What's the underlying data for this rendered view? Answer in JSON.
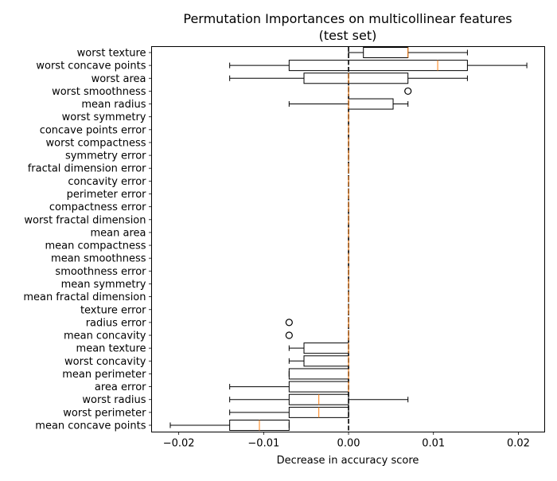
{
  "chart_data": {
    "type": "boxplot",
    "orientation": "horizontal",
    "title": "Permutation Importances on multicollinear features\n(test set)",
    "title_lines": [
      "Permutation Importances on multicollinear features",
      "(test set)"
    ],
    "xlabel": "Decrease in accuracy score",
    "ylabel": "",
    "xlim": [
      -0.0232,
      0.0231
    ],
    "xticks": [
      -0.02,
      -0.01,
      0.0,
      0.01,
      0.02
    ],
    "xtick_labels": [
      "−0.02",
      "−0.01",
      "0.00",
      "0.01",
      "0.02"
    ],
    "reference_line": {
      "x": 0,
      "style": "dashed",
      "color": "#000000"
    },
    "median_color": "#ff7f0e",
    "grid": false,
    "categories": [
      "worst texture",
      "worst concave points",
      "worst area",
      "worst smoothness",
      "mean radius",
      "worst symmetry",
      "concave points error",
      "worst compactness",
      "symmetry error",
      "fractal dimension error",
      "concavity error",
      "perimeter error",
      "compactness error",
      "worst fractal dimension",
      "mean area",
      "mean compactness",
      "mean smoothness",
      "smoothness error",
      "mean symmetry",
      "mean fractal dimension",
      "texture error",
      "radius error",
      "mean concavity",
      "mean texture",
      "worst concavity",
      "mean perimeter",
      "area error",
      "worst radius",
      "worst perimeter",
      "mean concave points"
    ],
    "boxes": [
      {
        "whisker_low": 0,
        "q1": 0.00175,
        "median": 0.007,
        "q3": 0.007,
        "whisker_high": 0.014,
        "outliers": []
      },
      {
        "whisker_low": -0.014,
        "q1": -0.007,
        "median": 0.0105,
        "q3": 0.014,
        "whisker_high": 0.021,
        "outliers": []
      },
      {
        "whisker_low": -0.014,
        "q1": -0.00525,
        "median": 0,
        "q3": 0.007,
        "whisker_high": 0.014,
        "outliers": []
      },
      {
        "whisker_low": 0,
        "q1": 0,
        "median": 0,
        "q3": 0,
        "whisker_high": 0,
        "outliers": [
          0.007
        ]
      },
      {
        "whisker_low": -0.007,
        "q1": 0,
        "median": 0,
        "q3": 0.00525,
        "whisker_high": 0.007,
        "outliers": []
      },
      {
        "whisker_low": 0,
        "q1": 0,
        "median": 0,
        "q3": 0,
        "whisker_high": 0,
        "outliers": []
      },
      {
        "whisker_low": 0,
        "q1": 0,
        "median": 0,
        "q3": 0,
        "whisker_high": 0,
        "outliers": []
      },
      {
        "whisker_low": 0,
        "q1": 0,
        "median": 0,
        "q3": 0,
        "whisker_high": 0,
        "outliers": []
      },
      {
        "whisker_low": 0,
        "q1": 0,
        "median": 0,
        "q3": 0,
        "whisker_high": 0,
        "outliers": []
      },
      {
        "whisker_low": 0,
        "q1": 0,
        "median": 0,
        "q3": 0,
        "whisker_high": 0,
        "outliers": []
      },
      {
        "whisker_low": 0,
        "q1": 0,
        "median": 0,
        "q3": 0,
        "whisker_high": 0,
        "outliers": []
      },
      {
        "whisker_low": 0,
        "q1": 0,
        "median": 0,
        "q3": 0,
        "whisker_high": 0,
        "outliers": []
      },
      {
        "whisker_low": 0,
        "q1": 0,
        "median": 0,
        "q3": 0,
        "whisker_high": 0,
        "outliers": []
      },
      {
        "whisker_low": 0,
        "q1": 0,
        "median": 0,
        "q3": 0,
        "whisker_high": 0,
        "outliers": []
      },
      {
        "whisker_low": 0,
        "q1": 0,
        "median": 0,
        "q3": 0,
        "whisker_high": 0,
        "outliers": []
      },
      {
        "whisker_low": 0,
        "q1": 0,
        "median": 0,
        "q3": 0,
        "whisker_high": 0,
        "outliers": []
      },
      {
        "whisker_low": 0,
        "q1": 0,
        "median": 0,
        "q3": 0,
        "whisker_high": 0,
        "outliers": []
      },
      {
        "whisker_low": 0,
        "q1": 0,
        "median": 0,
        "q3": 0,
        "whisker_high": 0,
        "outliers": []
      },
      {
        "whisker_low": 0,
        "q1": 0,
        "median": 0,
        "q3": 0,
        "whisker_high": 0,
        "outliers": []
      },
      {
        "whisker_low": 0,
        "q1": 0,
        "median": 0,
        "q3": 0,
        "whisker_high": 0,
        "outliers": []
      },
      {
        "whisker_low": 0,
        "q1": 0,
        "median": 0,
        "q3": 0,
        "whisker_high": 0,
        "outliers": []
      },
      {
        "whisker_low": 0,
        "q1": 0,
        "median": 0,
        "q3": 0,
        "whisker_high": 0,
        "outliers": [
          -0.007
        ]
      },
      {
        "whisker_low": 0,
        "q1": 0,
        "median": 0,
        "q3": 0,
        "whisker_high": 0,
        "outliers": [
          -0.007
        ]
      },
      {
        "whisker_low": -0.007,
        "q1": -0.00525,
        "median": 0,
        "q3": 0,
        "whisker_high": 0,
        "outliers": []
      },
      {
        "whisker_low": -0.007,
        "q1": -0.00525,
        "median": 0,
        "q3": 0,
        "whisker_high": 0,
        "outliers": []
      },
      {
        "whisker_low": -0.007,
        "q1": -0.007,
        "median": 0,
        "q3": 0,
        "whisker_high": 0,
        "outliers": []
      },
      {
        "whisker_low": -0.014,
        "q1": -0.007,
        "median": 0,
        "q3": 0,
        "whisker_high": 0,
        "outliers": []
      },
      {
        "whisker_low": -0.014,
        "q1": -0.007,
        "median": -0.0035,
        "q3": 0,
        "whisker_high": 0.007,
        "outliers": []
      },
      {
        "whisker_low": -0.014,
        "q1": -0.007,
        "median": -0.0035,
        "q3": 0,
        "whisker_high": 0,
        "outliers": []
      },
      {
        "whisker_low": -0.021,
        "q1": -0.014,
        "median": -0.0105,
        "q3": -0.007,
        "whisker_high": -0.007,
        "outliers": []
      }
    ]
  }
}
